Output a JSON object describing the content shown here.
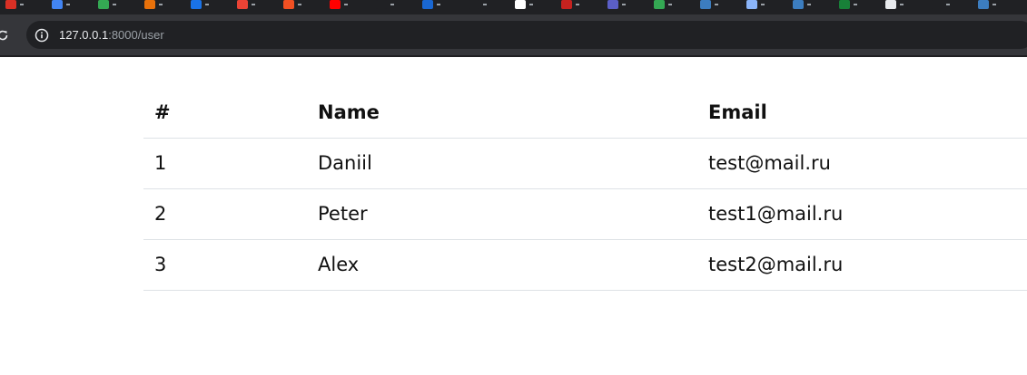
{
  "browser": {
    "url_host": "127.0.0.1",
    "url_path": ":8000/user",
    "bookmarks": [
      {
        "icon": "bookmark-favicon",
        "color": "#d93025"
      },
      {
        "icon": "bookmark-favicon",
        "color": "#4285f4"
      },
      {
        "icon": "bookmark-favicon",
        "color": "#34a853"
      },
      {
        "icon": "bookmark-favicon",
        "color": "#e8710a"
      },
      {
        "icon": "bookmark-favicon",
        "color": "#1a73e8"
      },
      {
        "icon": "bookmark-favicon",
        "color": "#ea4335"
      },
      {
        "icon": "bookmark-favicon",
        "color": "#f25022"
      },
      {
        "icon": "bookmark-favicon",
        "color": "#ff0000"
      },
      {
        "icon": "bookmark-favicon",
        "color": "#202124"
      },
      {
        "icon": "bookmark-favicon",
        "color": "#1967d2"
      },
      {
        "icon": "bookmark-favicon",
        "color": "#202124"
      },
      {
        "icon": "bookmark-favicon",
        "color": "#ffffff"
      },
      {
        "icon": "bookmark-favicon",
        "color": "#c5221f"
      },
      {
        "icon": "bookmark-favicon",
        "color": "#5b5fc7"
      },
      {
        "icon": "bookmark-favicon",
        "color": "#34a853"
      },
      {
        "icon": "bookmark-favicon",
        "color": "#3c7dbf"
      },
      {
        "icon": "bookmark-favicon",
        "color": "#8ab4f8"
      },
      {
        "icon": "bookmark-favicon",
        "color": "#3c7dbf"
      },
      {
        "icon": "bookmark-favicon",
        "color": "#188038"
      },
      {
        "icon": "bookmark-favicon",
        "color": "#e8eaed"
      },
      {
        "icon": "bookmark-favicon",
        "color": "#202124"
      },
      {
        "icon": "bookmark-favicon",
        "color": "#3c7dbf"
      }
    ]
  },
  "table": {
    "headers": [
      "#",
      "Name",
      "Email"
    ],
    "rows": [
      {
        "id": "1",
        "name": "Daniil",
        "email": "test@mail.ru"
      },
      {
        "id": "2",
        "name": "Peter",
        "email": "test1@mail.ru"
      },
      {
        "id": "3",
        "name": "Alex",
        "email": "test2@mail.ru"
      }
    ]
  }
}
